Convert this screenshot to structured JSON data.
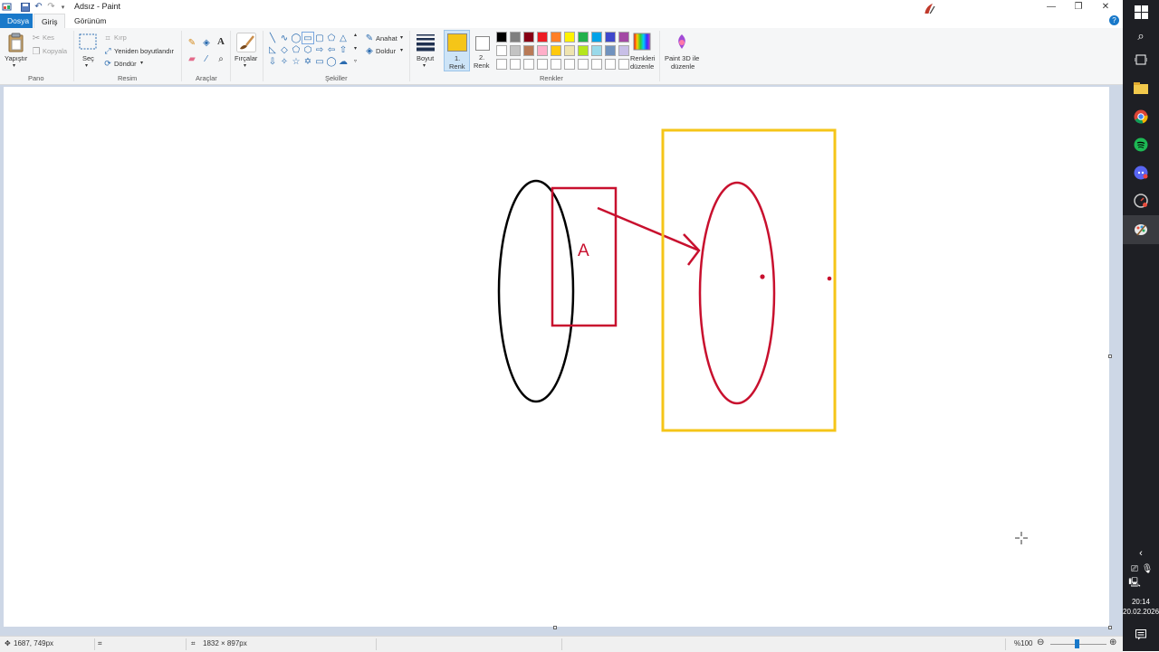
{
  "window": {
    "title": "Adsız - Paint",
    "minimize_glyph": "—",
    "restore_glyph": "❐",
    "close_glyph": "✕"
  },
  "quick_access": {
    "icons": [
      "paint-app-icon",
      "save-icon",
      "undo-icon",
      "redo-icon",
      "customize-dropdown-icon"
    ]
  },
  "tabs": {
    "file": "Dosya",
    "home": "Giriş",
    "view": "Görünüm"
  },
  "clipboard": {
    "paste": "Yapıştır",
    "cut": "Kes",
    "copy": "Kopyala",
    "label": "Pano"
  },
  "image": {
    "select": "Seç",
    "crop": "Kırp",
    "resize": "Yeniden boyutlandır",
    "rotate": "Döndür",
    "label": "Resim"
  },
  "tools": {
    "label": "Araçlar",
    "text_tool": "A"
  },
  "brushes": {
    "label": "Fırçalar"
  },
  "shapes": {
    "label": "Şekiller",
    "outline": "Anahat",
    "fill": "Doldur"
  },
  "size": {
    "label": "Boyut"
  },
  "colors": {
    "color1_label_line1": "1.",
    "color1_label_line2": "Renk",
    "color2_label_line1": "2.",
    "color2_label_line2": "Renk",
    "color1": "#f5c518",
    "color2": "#ffffff",
    "edit_colors_line1": "Renkleri",
    "edit_colors_line2": "düzenle",
    "paint3d_line1": "Paint 3D ile",
    "paint3d_line2": "düzenle",
    "label": "Renkler",
    "palette_row1": [
      "#000000",
      "#7f7f7f",
      "#880015",
      "#ed1c24",
      "#ff7f27",
      "#fff200",
      "#22b14c",
      "#00a2e8",
      "#3f48cc",
      "#a349a4"
    ],
    "palette_row2": [
      "#ffffff",
      "#c3c3c3",
      "#b97a57",
      "#ffaec9",
      "#ffc90e",
      "#efe4b0",
      "#b5e61d",
      "#99d9ea",
      "#7092be",
      "#c8bfe7"
    ],
    "palette_row3": [
      "#ffffff",
      "#ffffff",
      "#ffffff",
      "#ffffff",
      "#ffffff",
      "#ffffff",
      "#ffffff",
      "#ffffff",
      "#ffffff",
      "#ffffff"
    ]
  },
  "drawing": {
    "text_label": "A",
    "black_stroke": "#000000",
    "red_stroke": "#c8102e",
    "yellow_stroke": "#f5c518"
  },
  "status": {
    "cursor_position": "1687, 749px",
    "canvas_size": "1832 × 897px",
    "zoom": "%100"
  },
  "taskbar": {
    "time": "20:14",
    "date": "20.02.2026"
  }
}
